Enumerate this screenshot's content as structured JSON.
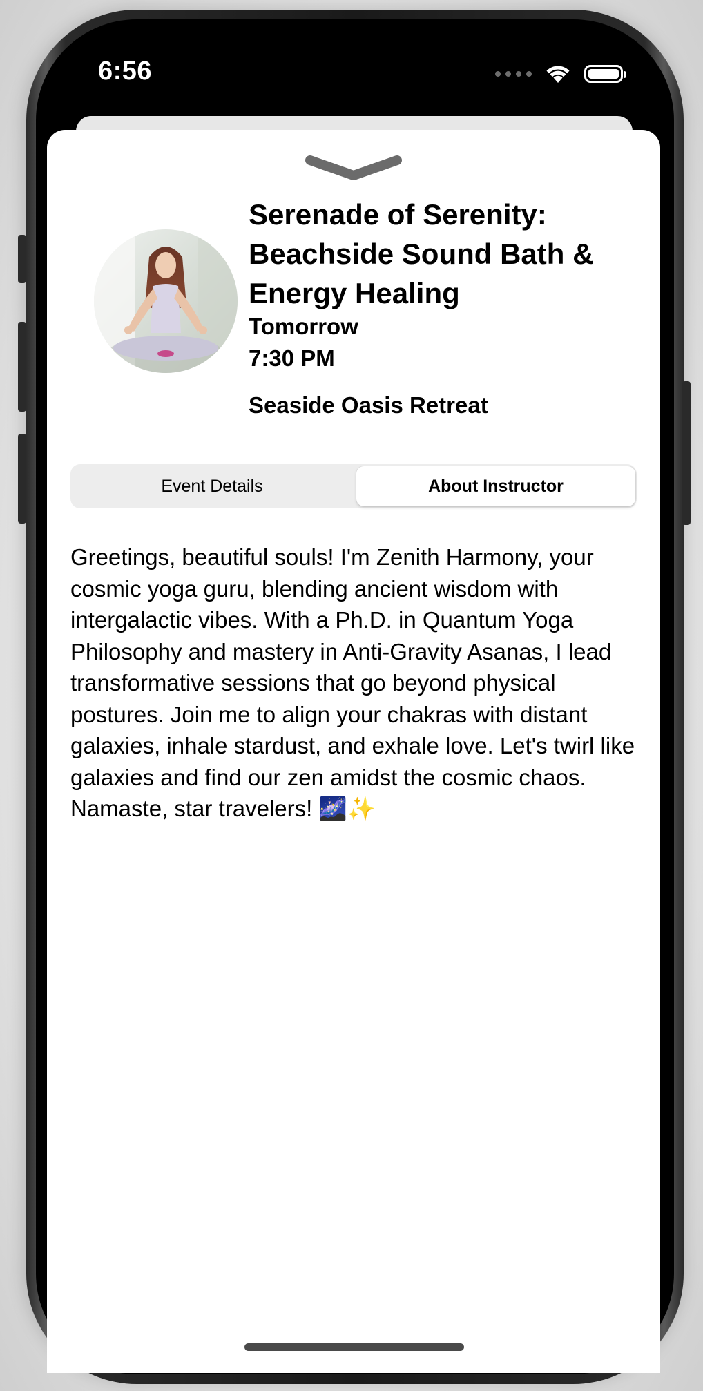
{
  "status_bar": {
    "time": "6:56"
  },
  "event": {
    "title": "Serenade of Serenity: Beachside Sound Bath & Energy Healing",
    "day": "Tomorrow",
    "time": "7:30 PM",
    "venue": "Seaside Oasis Retreat"
  },
  "tabs": [
    {
      "label": "Event Details",
      "selected": false
    },
    {
      "label": "About Instructor",
      "selected": true
    }
  ],
  "bio": "Greetings, beautiful souls! I'm Zenith Harmony, your cosmic yoga guru, blending ancient wisdom with intergalactic vibes. With a Ph.D. in Quantum Yoga Philosophy and mastery in Anti-Gravity Asanas, I lead transformative sessions that go beyond physical postures. Join me to align your chakras with distant galaxies, inhale stardust, and exhale love. Let's twirl like galaxies and find our zen amidst the cosmic chaos. Namaste, star travelers! 🌌✨",
  "icons": {
    "grabber": "chevron-down-icon",
    "wifi": "wifi-icon",
    "battery": "battery-icon",
    "signal": "cellular-signal-icon",
    "avatar": "instructor-avatar"
  },
  "colors": {
    "segment_background": "#ededed",
    "segment_selected": "#ffffff",
    "grabber": "#6b6b6b",
    "text": "#000000"
  }
}
